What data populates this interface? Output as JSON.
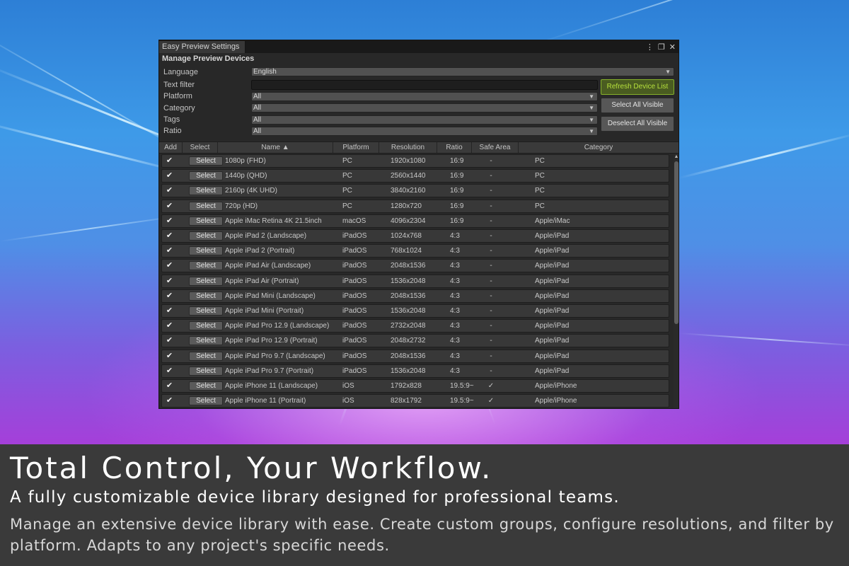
{
  "window": {
    "tab_title": "Easy Preview Settings",
    "controls": {
      "menu": "⋮",
      "maximize": "❐",
      "close": "✕"
    }
  },
  "panel": {
    "title": "Manage Preview Devices",
    "language": {
      "label": "Language",
      "value": "English"
    },
    "text_filter": {
      "label": "Text filter",
      "value": "",
      "placeholder": ""
    },
    "platform": {
      "label": "Platform",
      "value": "All"
    },
    "category": {
      "label": "Category",
      "value": "All"
    },
    "tags": {
      "label": "Tags",
      "value": "All"
    },
    "ratio": {
      "label": "Ratio",
      "value": "All"
    },
    "buttons": {
      "refresh": "Refresh Device List",
      "select_all": "Select All Visible",
      "deselect_all": "Deselect All Visible"
    }
  },
  "table": {
    "headers": {
      "add": "Add",
      "select": "Select",
      "name": "Name ▲",
      "platform": "Platform",
      "resolution": "Resolution",
      "ratio": "Ratio",
      "safe_area": "Safe Area",
      "category": "Category"
    },
    "select_label": "Select",
    "check_glyph": "✔",
    "rows": [
      {
        "name": "1080p (FHD)",
        "platform": "PC",
        "resolution": "1920x1080",
        "ratio": "16:9",
        "safe": "-",
        "category": "PC"
      },
      {
        "name": "1440p (QHD)",
        "platform": "PC",
        "resolution": "2560x1440",
        "ratio": "16:9",
        "safe": "-",
        "category": "PC"
      },
      {
        "name": "2160p (4K UHD)",
        "platform": "PC",
        "resolution": "3840x2160",
        "ratio": "16:9",
        "safe": "-",
        "category": "PC"
      },
      {
        "name": "720p (HD)",
        "platform": "PC",
        "resolution": "1280x720",
        "ratio": "16:9",
        "safe": "-",
        "category": "PC"
      },
      {
        "name": "Apple iMac Retina 4K 21.5inch",
        "platform": "macOS",
        "resolution": "4096x2304",
        "ratio": "16:9",
        "safe": "-",
        "category": "Apple/iMac"
      },
      {
        "name": "Apple iPad 2 (Landscape)",
        "platform": "iPadOS",
        "resolution": "1024x768",
        "ratio": "4:3",
        "safe": "-",
        "category": "Apple/iPad"
      },
      {
        "name": "Apple iPad 2 (Portrait)",
        "platform": "iPadOS",
        "resolution": "768x1024",
        "ratio": "4:3",
        "safe": "-",
        "category": "Apple/iPad"
      },
      {
        "name": "Apple iPad Air (Landscape)",
        "platform": "iPadOS",
        "resolution": "2048x1536",
        "ratio": "4:3",
        "safe": "-",
        "category": "Apple/iPad"
      },
      {
        "name": "Apple iPad Air (Portrait)",
        "platform": "iPadOS",
        "resolution": "1536x2048",
        "ratio": "4:3",
        "safe": "-",
        "category": "Apple/iPad"
      },
      {
        "name": "Apple iPad Mini (Landscape)",
        "platform": "iPadOS",
        "resolution": "2048x1536",
        "ratio": "4:3",
        "safe": "-",
        "category": "Apple/iPad"
      },
      {
        "name": "Apple iPad Mini (Portrait)",
        "platform": "iPadOS",
        "resolution": "1536x2048",
        "ratio": "4:3",
        "safe": "-",
        "category": "Apple/iPad"
      },
      {
        "name": "Apple iPad Pro 12.9 (Landscape)",
        "platform": "iPadOS",
        "resolution": "2732x2048",
        "ratio": "4:3",
        "safe": "-",
        "category": "Apple/iPad"
      },
      {
        "name": "Apple iPad Pro 12.9 (Portrait)",
        "platform": "iPadOS",
        "resolution": "2048x2732",
        "ratio": "4:3",
        "safe": "-",
        "category": "Apple/iPad"
      },
      {
        "name": "Apple iPad Pro 9.7 (Landscape)",
        "platform": "iPadOS",
        "resolution": "2048x1536",
        "ratio": "4:3",
        "safe": "-",
        "category": "Apple/iPad"
      },
      {
        "name": "Apple iPad Pro 9.7 (Portrait)",
        "platform": "iPadOS",
        "resolution": "1536x2048",
        "ratio": "4:3",
        "safe": "-",
        "category": "Apple/iPad"
      },
      {
        "name": "Apple iPhone 11 (Landscape)",
        "platform": "iOS",
        "resolution": "1792x828",
        "ratio": "19.5:9~",
        "safe": "✓",
        "category": "Apple/iPhone"
      },
      {
        "name": "Apple iPhone 11 (Portrait)",
        "platform": "iOS",
        "resolution": "828x1792",
        "ratio": "19.5:9~",
        "safe": "✓",
        "category": "Apple/iPhone"
      }
    ]
  },
  "caption": {
    "headline": "Total Control, Your Workflow.",
    "subheadline": "A fully customizable device library designed for professional teams.",
    "body": "Manage an extensive device library with ease. Create custom groups, configure resolutions, and filter by platform. Adapts to any project's specific needs."
  }
}
